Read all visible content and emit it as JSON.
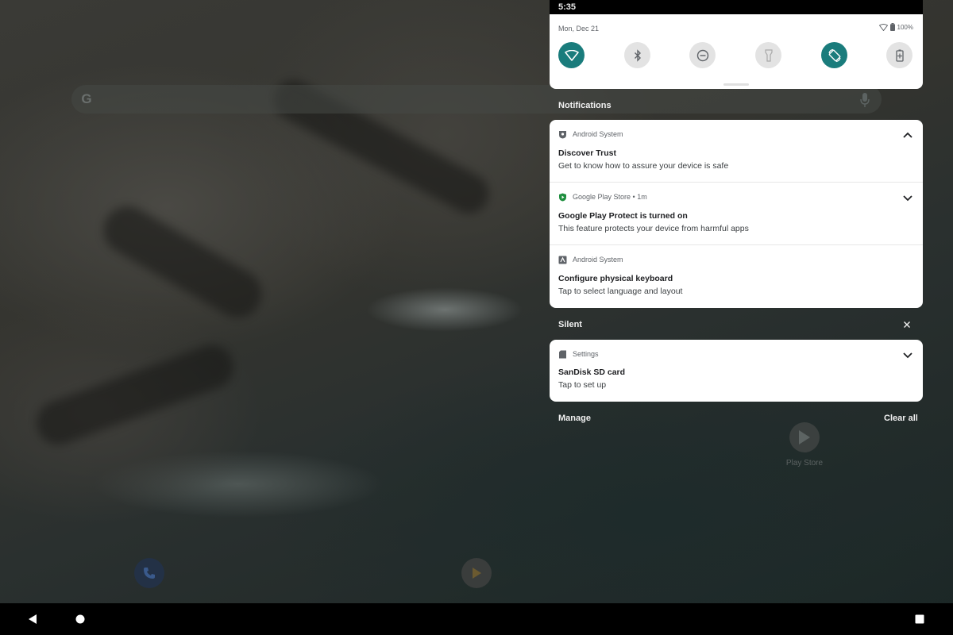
{
  "status_bar": {
    "time": "5:35",
    "battery": "100%"
  },
  "quick_settings": {
    "date": "Mon, Dec 21",
    "tiles": [
      {
        "name": "wifi",
        "icon": "wifi-icon",
        "state": "on"
      },
      {
        "name": "bluetooth",
        "icon": "bluetooth-icon",
        "state": "off"
      },
      {
        "name": "do-not-disturb",
        "icon": "do-not-disturb-icon",
        "state": "off"
      },
      {
        "name": "flashlight",
        "icon": "flashlight-icon",
        "state": "off"
      },
      {
        "name": "auto-rotate",
        "icon": "auto-rotate-icon",
        "state": "on"
      },
      {
        "name": "battery-saver",
        "icon": "battery-saver-icon",
        "state": "off"
      }
    ],
    "accent": "#1a7c7c"
  },
  "notifications": {
    "header": "Notifications",
    "items": [
      {
        "app": "Android System",
        "title": "Discover Trust",
        "body": "Get to know how to assure your device is safe",
        "expanded": true
      },
      {
        "app": "Google Play Store • 1m",
        "title": "Google Play Protect is turned on",
        "body": "This feature protects your device from harmful apps",
        "expanded": false
      },
      {
        "app": "Android System",
        "title": "Configure physical keyboard",
        "body": "Tap to select language and layout",
        "expanded": null
      }
    ]
  },
  "silent": {
    "header": "Silent",
    "items": [
      {
        "app": "Settings",
        "title": "SanDisk SD card",
        "body": "Tap to set up",
        "expanded": false
      }
    ]
  },
  "footer": {
    "manage": "Manage",
    "clear_all": "Clear all"
  },
  "home": {
    "play_store_label": "Play Store"
  }
}
